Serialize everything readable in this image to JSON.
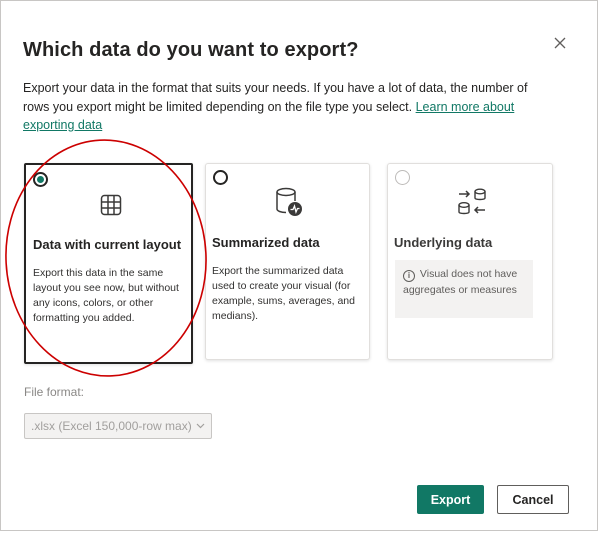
{
  "dialog": {
    "title": "Which data do you want to export?",
    "description_text": "Export your data in the format that suits your needs. If you have a lot of data, the number of rows you export might be limited depending on the file type you select.",
    "learn_more_link": "Learn more about exporting data"
  },
  "options": [
    {
      "title": "Data with current layout",
      "description": "Export this data in the same layout you see now, but without any icons, colors, or other formatting you added.",
      "selected": true,
      "icon": "table-grid-icon"
    },
    {
      "title": "Summarized data",
      "description": "Export the summarized data used to create your visual (for example, sums, averages, and medians).",
      "selected": false,
      "icon": "database-chart-icon"
    },
    {
      "title": "Underlying data",
      "notice": "Visual does not have aggregates or measures",
      "disabled": true,
      "icon": "database-sync-icon"
    }
  ],
  "file_format": {
    "label": "File format:",
    "value": ".xlsx (Excel 150,000-row max)"
  },
  "buttons": {
    "export": "Export",
    "cancel": "Cancel"
  },
  "colors": {
    "accent": "#117865",
    "annotation": "#cc0000"
  }
}
